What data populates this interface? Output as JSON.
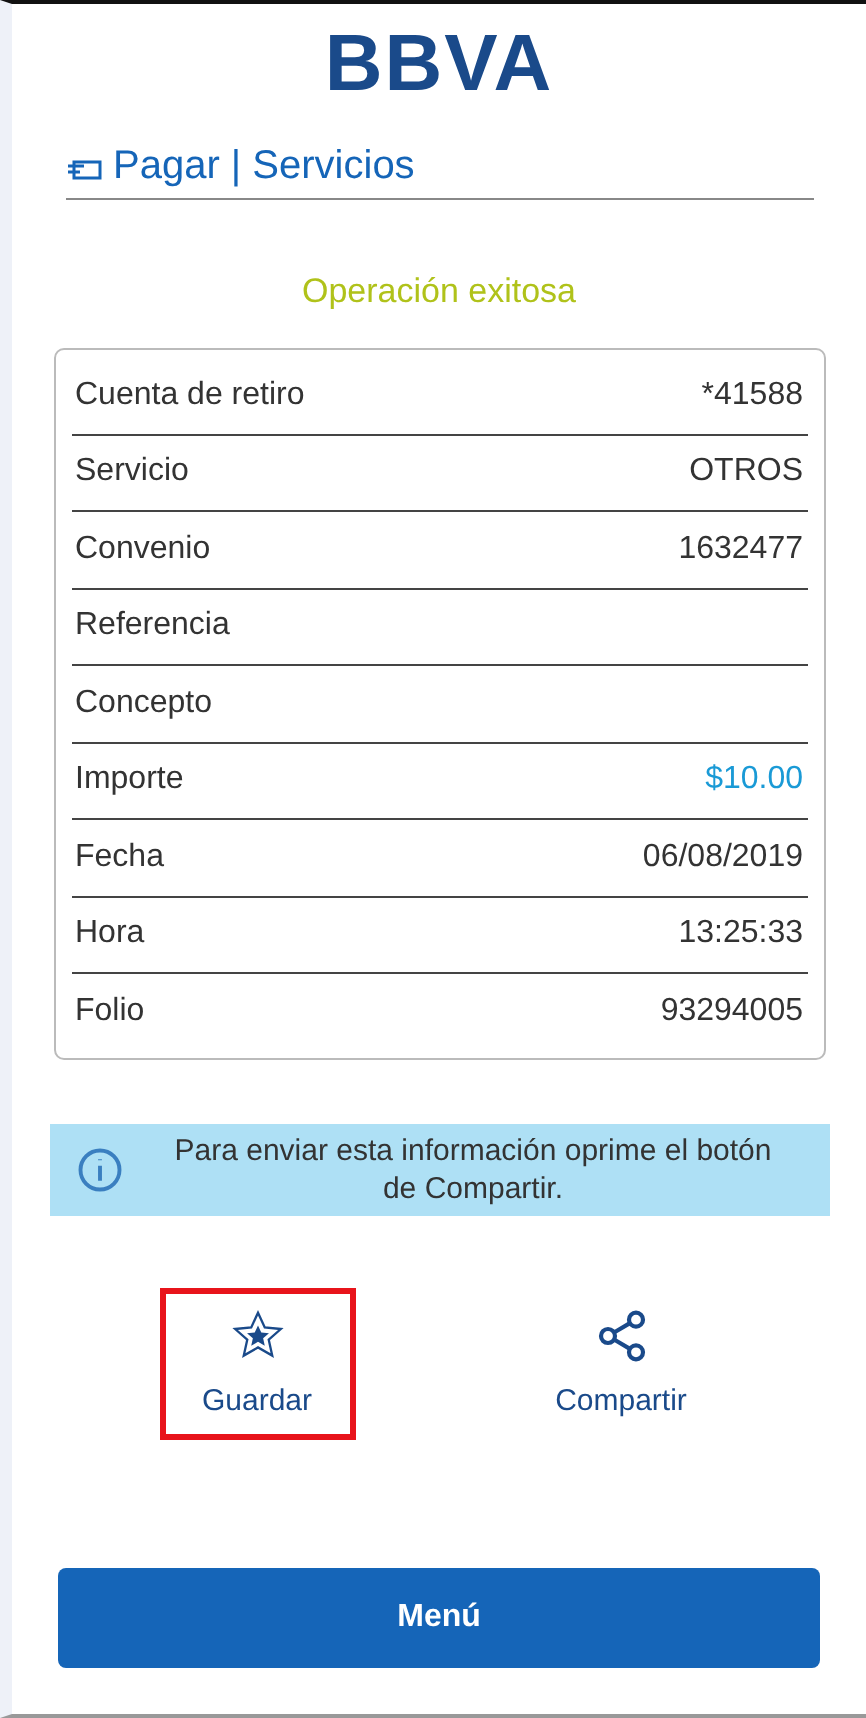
{
  "logo": "BBVA",
  "header": {
    "title": "Pagar | Servicios"
  },
  "status": "Operación exitosa",
  "rows": [
    {
      "label": "Cuenta de retiro",
      "value": "*41588",
      "kind": "plain"
    },
    {
      "label": "Servicio",
      "value": "OTROS",
      "kind": "plain"
    },
    {
      "label": "Convenio",
      "value": "1632477",
      "kind": "plain"
    },
    {
      "label": "Referencia"
    },
    {
      "label": "Concepto"
    },
    {
      "label": "Importe",
      "value": "$10.00",
      "kind": "amount"
    },
    {
      "label": "Fecha",
      "value": "06/08/2019",
      "kind": "plain"
    },
    {
      "label": "Hora",
      "value": "13:25:33",
      "kind": "plain"
    },
    {
      "label": "Folio",
      "value": "93294005",
      "kind": "plain"
    }
  ],
  "info": "Para enviar esta información oprime el botón de Compartir.",
  "actions": [
    {
      "label": "Guardar",
      "kind": "star",
      "highlighted": true
    },
    {
      "label": "Compartir",
      "kind": "share",
      "highlighted": false
    }
  ],
  "menu_button": "Menú"
}
